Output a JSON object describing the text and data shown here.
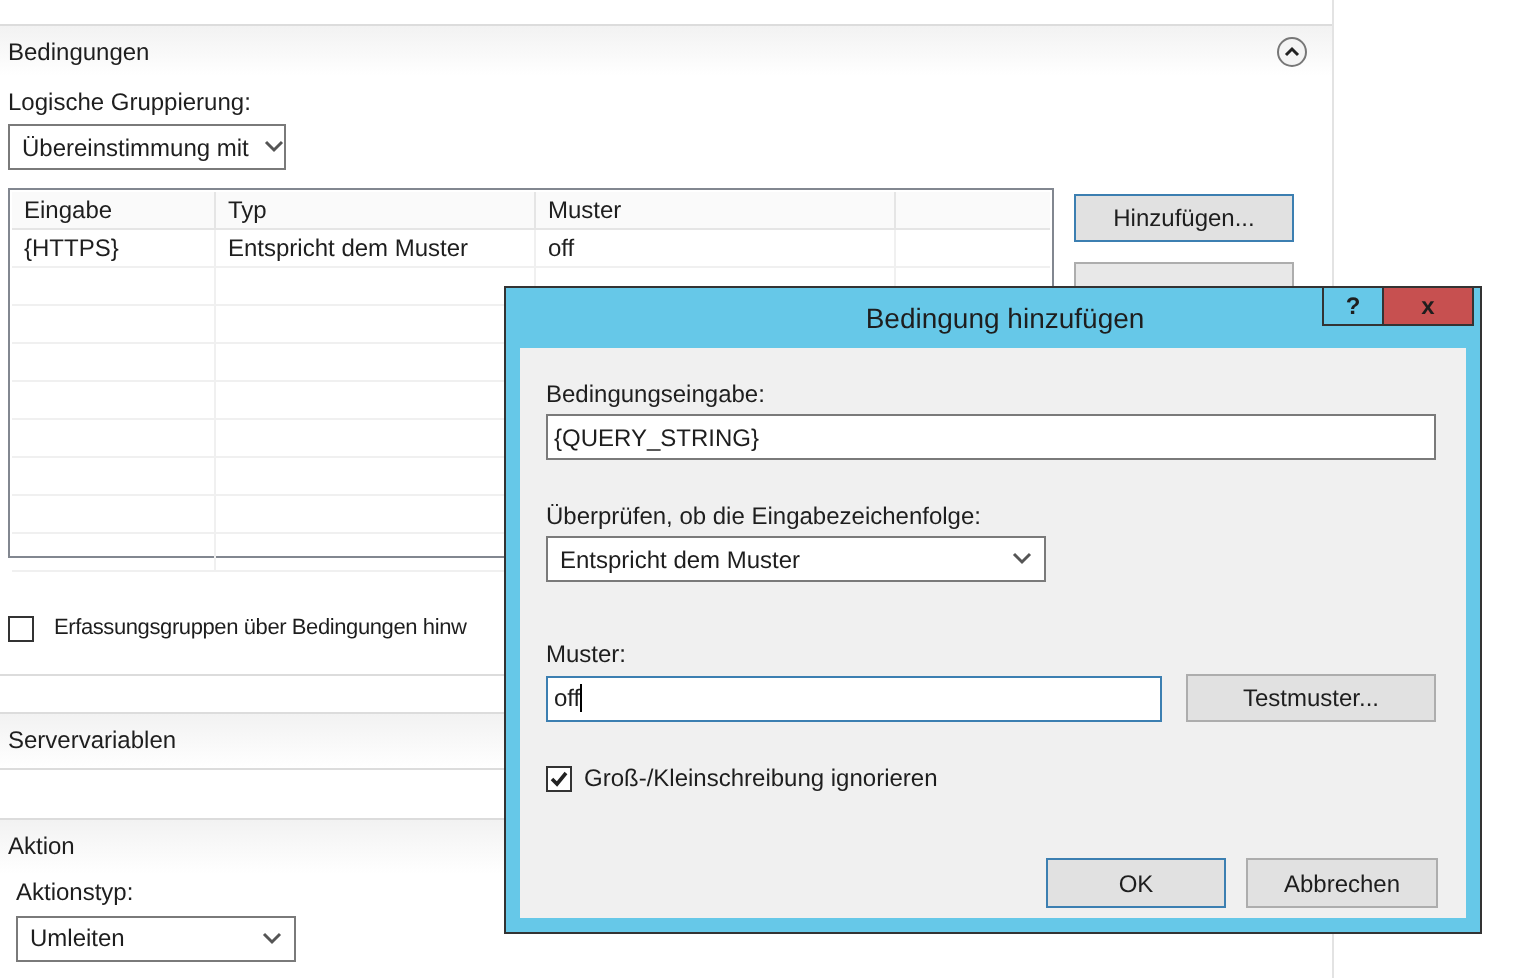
{
  "conditions": {
    "title": "Bedingungen",
    "grouping_label": "Logische Gruppierung:",
    "grouping_value": "Übereinstimmung mit",
    "table": {
      "columns": [
        "Eingabe",
        "Typ",
        "Muster"
      ],
      "rows": [
        {
          "cells": [
            "{HTTPS}",
            "Entspricht dem Muster",
            "off"
          ]
        }
      ]
    },
    "add_button": "Hinzufügen...",
    "capture_groups": {
      "label": "Erfassungsgruppen über Bedingungen hinw",
      "checked": false
    }
  },
  "server_variables": {
    "title": "Servervariablen"
  },
  "action": {
    "title": "Aktion",
    "type_label": "Aktionstyp:",
    "type_value": "Umleiten"
  },
  "dialog": {
    "title": "Bedingung hinzufügen",
    "help": "?",
    "close": "x",
    "input_label": "Bedingungseingabe:",
    "input_value": "{QUERY_STRING}",
    "check_label": "Überprüfen, ob die Eingabezeichenfolge:",
    "check_value": "Entspricht dem Muster",
    "pattern_label": "Muster:",
    "pattern_value": "off",
    "test_button": "Testmuster...",
    "ignore_case": {
      "label": "Groß-/Kleinschreibung ignorieren",
      "checked": true
    },
    "buttons": [
      "OK",
      "Abbrechen"
    ]
  }
}
